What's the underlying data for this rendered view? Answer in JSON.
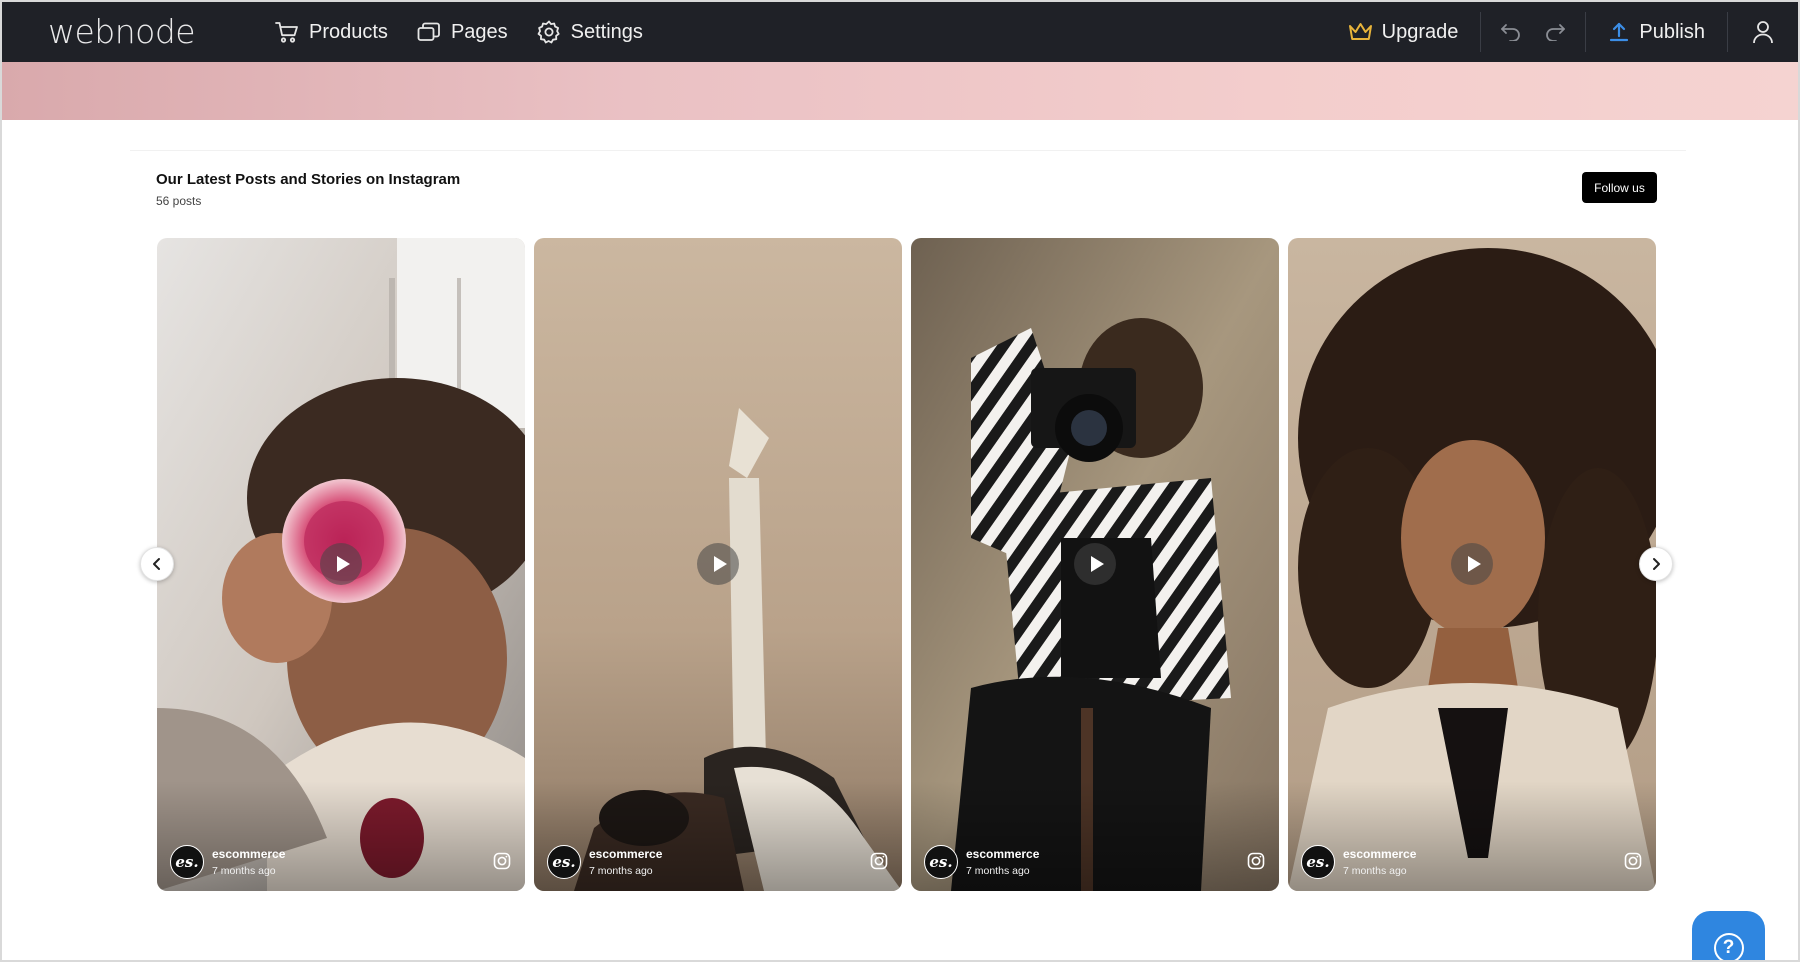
{
  "topbar": {
    "logo": "webnode",
    "nav": [
      {
        "label": "Products",
        "icon": "cart-icon"
      },
      {
        "label": "Pages",
        "icon": "pages-icon"
      },
      {
        "label": "Settings",
        "icon": "gear-icon"
      }
    ],
    "upgrade_label": "Upgrade",
    "publish_label": "Publish",
    "accent_upgrade": "#e8b43a",
    "accent_publish": "#3c8ee6"
  },
  "feed": {
    "title": "Our Latest Posts and Stories on Instagram",
    "count": "56 posts",
    "follow_label": "Follow us",
    "posts": [
      {
        "username": "escommerce",
        "time": "7 months ago",
        "avatar": "es."
      },
      {
        "username": "escommerce",
        "time": "7 months ago",
        "avatar": "es."
      },
      {
        "username": "escommerce",
        "time": "7 months ago",
        "avatar": "es."
      },
      {
        "username": "escommerce",
        "time": "7 months ago",
        "avatar": "es."
      }
    ]
  },
  "help": {
    "symbol": "?"
  }
}
